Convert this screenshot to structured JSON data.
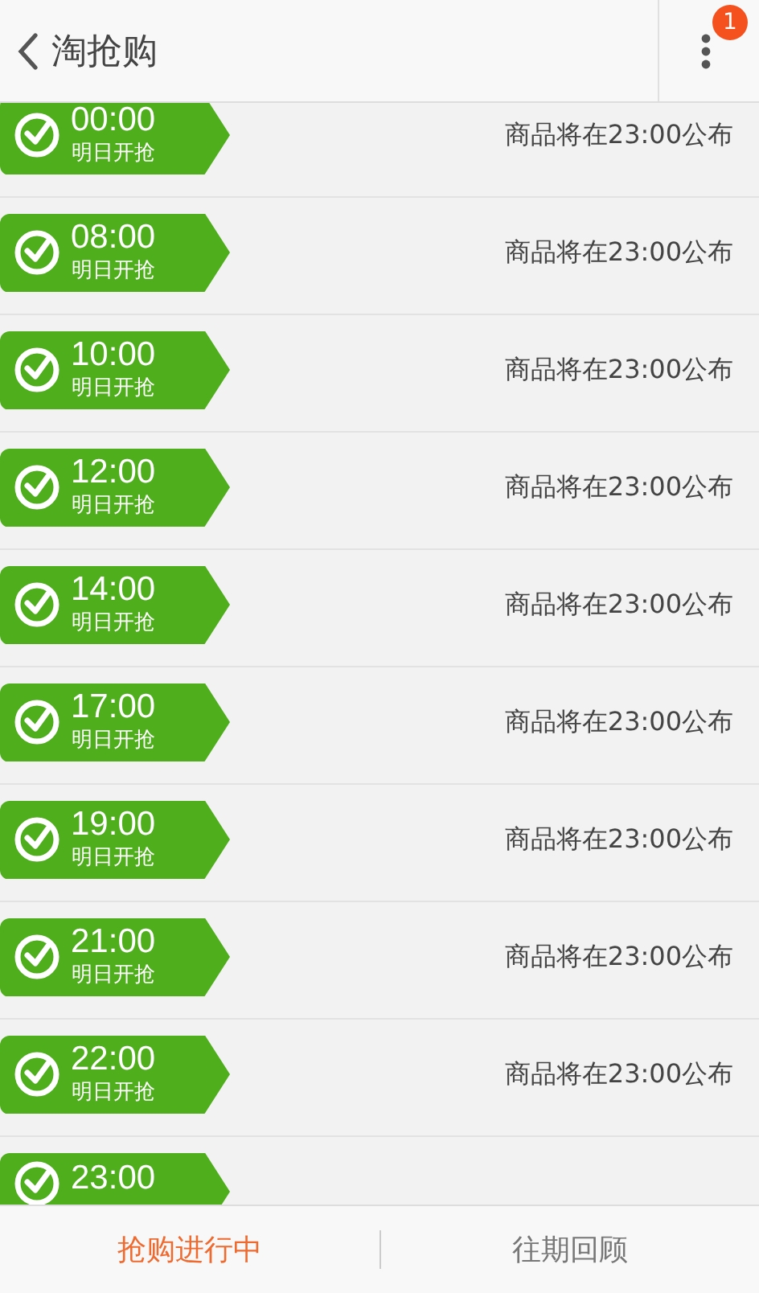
{
  "header": {
    "title": "淘抢购",
    "badge": "1"
  },
  "sessions": [
    {
      "time": "00:00",
      "status": "明日开抢",
      "notice": "商品将在23:00公布"
    },
    {
      "time": "08:00",
      "status": "明日开抢",
      "notice": "商品将在23:00公布"
    },
    {
      "time": "10:00",
      "status": "明日开抢",
      "notice": "商品将在23:00公布"
    },
    {
      "time": "12:00",
      "status": "明日开抢",
      "notice": "商品将在23:00公布"
    },
    {
      "time": "14:00",
      "status": "明日开抢",
      "notice": "商品将在23:00公布"
    },
    {
      "time": "17:00",
      "status": "明日开抢",
      "notice": "商品将在23:00公布"
    },
    {
      "time": "19:00",
      "status": "明日开抢",
      "notice": "商品将在23:00公布"
    },
    {
      "time": "21:00",
      "status": "明日开抢",
      "notice": "商品将在23:00公布"
    },
    {
      "time": "22:00",
      "status": "明日开抢",
      "notice": "商品将在23:00公布"
    },
    {
      "time": "23:00"
    }
  ],
  "bottom_tabs": [
    {
      "label": "抢购进行中",
      "selected": true
    },
    {
      "label": "往期回顾",
      "selected": false
    }
  ]
}
